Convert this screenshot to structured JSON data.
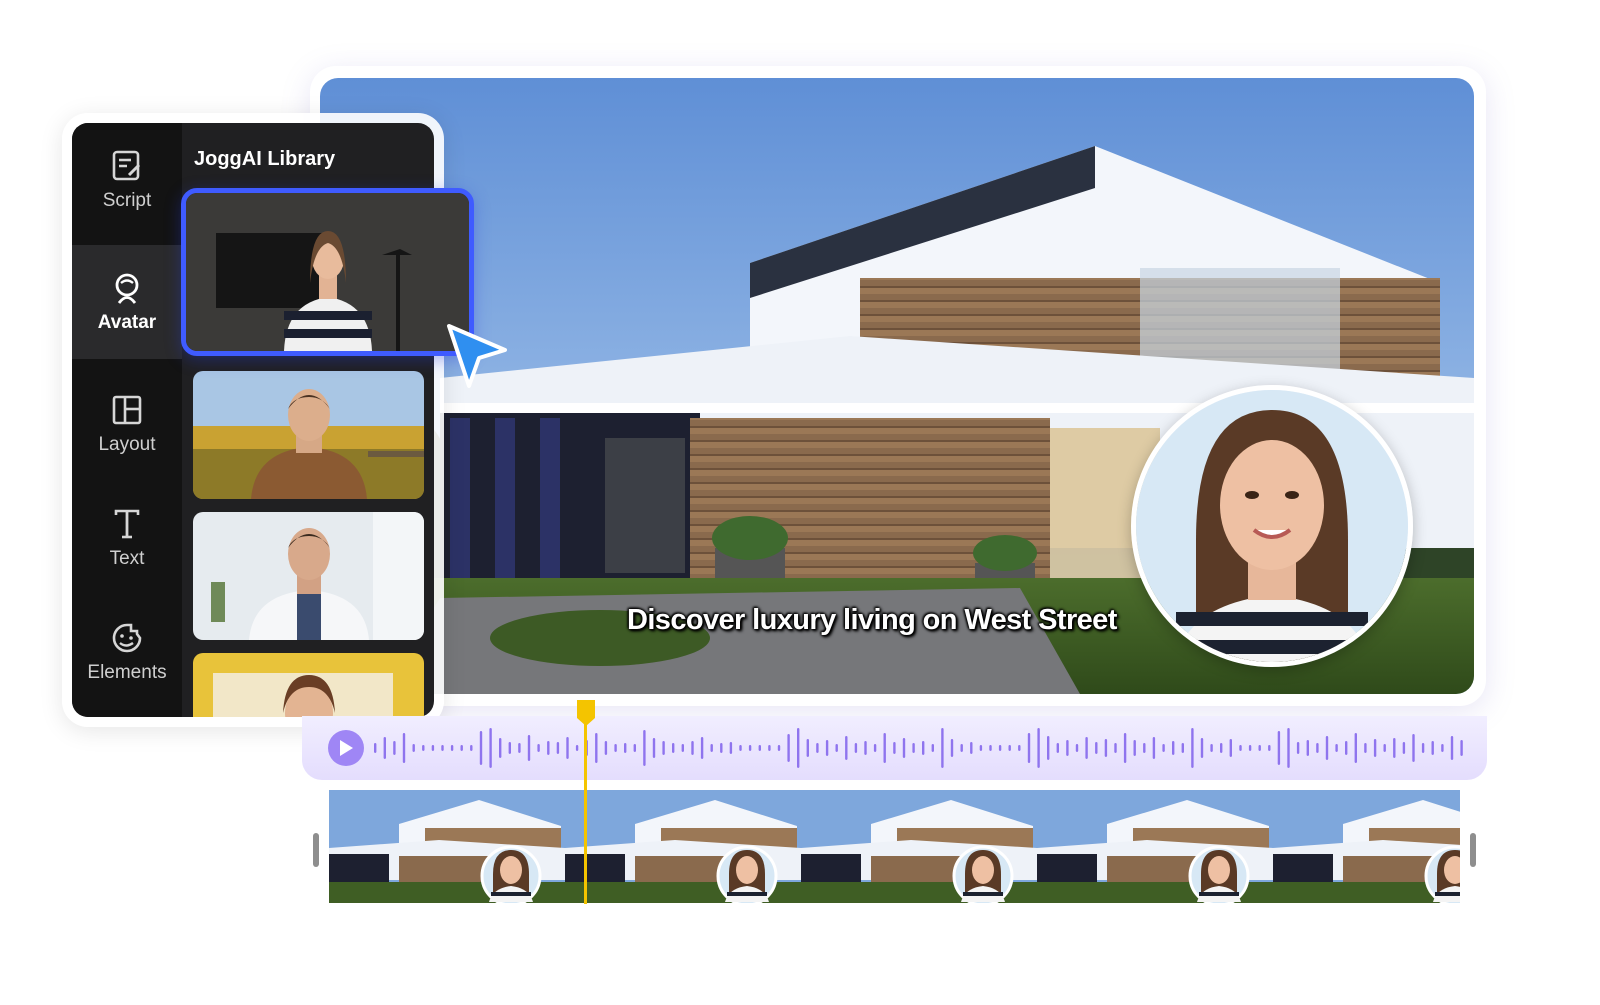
{
  "library": {
    "title": "JoggAI Library"
  },
  "sidebar": {
    "items": [
      {
        "label": "Script",
        "icon": "script-icon",
        "active": false
      },
      {
        "label": "Avatar",
        "icon": "avatar-icon",
        "active": true
      },
      {
        "label": "Layout",
        "icon": "layout-icon",
        "active": false
      },
      {
        "label": "Text",
        "icon": "text-icon",
        "active": false
      },
      {
        "label": "Elements",
        "icon": "elements-icon",
        "active": false
      }
    ]
  },
  "preview": {
    "caption": "Discover luxury living on West Street"
  },
  "colors": {
    "selection": "#3f5bff",
    "playhead": "#f4c400",
    "waveform": "#8f74ee",
    "panel": "#202022"
  }
}
